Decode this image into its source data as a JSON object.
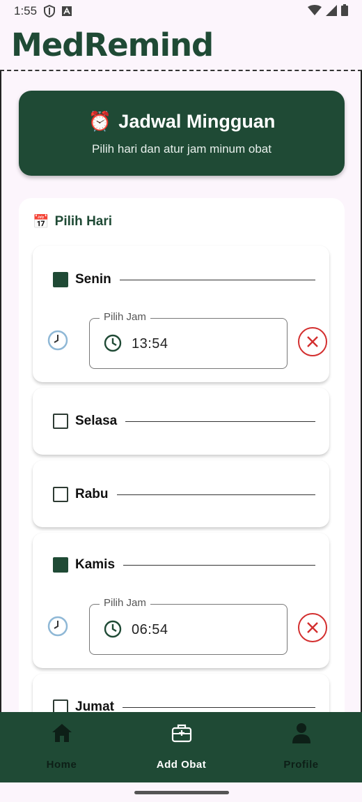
{
  "status_bar": {
    "time": "1:55",
    "icons": [
      "shield-icon",
      "a-icon",
      "wifi-icon",
      "signal-icon",
      "battery-icon"
    ]
  },
  "app": {
    "title": "MedRemind"
  },
  "banner": {
    "emoji": "⏰",
    "title": "Jadwal Mingguan",
    "subtitle": "Pilih hari dan atur jam minum obat"
  },
  "day_panel": {
    "emoji": "📅",
    "title": "Pilih Hari",
    "time_field_label": "Pilih Jam",
    "days": [
      {
        "name": "Senin",
        "checked": true,
        "time": "13:54"
      },
      {
        "name": "Selasa",
        "checked": false
      },
      {
        "name": "Rabu",
        "checked": false
      },
      {
        "name": "Kamis",
        "checked": true,
        "time": "06:54"
      },
      {
        "name": "Jumat",
        "checked": false
      }
    ]
  },
  "bottom_nav": {
    "items": [
      {
        "label": "Home",
        "icon": "home-icon",
        "active": false
      },
      {
        "label": "Add Obat",
        "icon": "medical-kit-icon",
        "active": true
      },
      {
        "label": "Profile",
        "icon": "person-icon",
        "active": false
      }
    ]
  },
  "colors": {
    "primary": "#1f4a35",
    "background": "#fcf5fc",
    "danger": "#d32f2f"
  }
}
